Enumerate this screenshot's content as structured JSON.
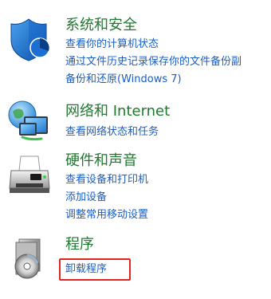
{
  "categories": [
    {
      "title": "系统和安全",
      "icon": "shield-icon",
      "links": [
        "查看你的计算机状态",
        "通过文件历史记录保存你的文件备份副",
        "备份和还原(Windows 7)"
      ]
    },
    {
      "title": "网络和 Internet",
      "icon": "network-globe-icon",
      "links": [
        "查看网络状态和任务"
      ]
    },
    {
      "title": "硬件和声音",
      "icon": "printer-icon",
      "links": [
        "查看设备和打印机",
        "添加设备",
        "调整常用移动设置"
      ]
    },
    {
      "title": "程序",
      "icon": "programs-disc-icon",
      "links": [
        "卸载程序"
      ]
    }
  ],
  "colors": {
    "title_green": "#1e7a2e",
    "link_blue": "#1a5ec2",
    "highlight_red": "#e3231f"
  }
}
